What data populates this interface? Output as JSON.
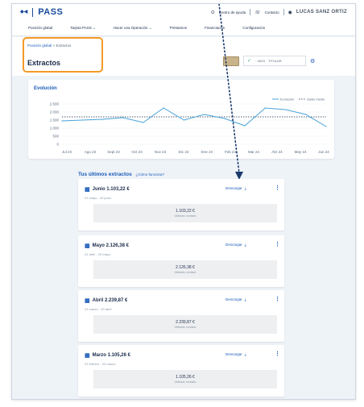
{
  "brand": {
    "name": "PASS"
  },
  "topbar": {
    "help": "Centro de ayuda",
    "contact": "Contacto",
    "user": "LUCAS SANZ ORTIZ"
  },
  "nav": [
    {
      "label": "Posición global"
    },
    {
      "label": "Tarjeta PASS"
    },
    {
      "label": "Hacer una Operación"
    },
    {
      "label": "Préstamos"
    },
    {
      "label": "Financiación"
    },
    {
      "label": "Configuración"
    }
  ],
  "breadcrumb": {
    "home": "Posición global",
    "sep": ">",
    "current": "Extractos"
  },
  "page": {
    "title": "Extractos"
  },
  "account": {
    "number": "···4815",
    "holder": "TITULAR"
  },
  "chart_data": {
    "type": "line",
    "title": "Evolución",
    "categories": [
      "Jul 23",
      "Ago 23",
      "Sept 23",
      "Oct 23",
      "Nov 23",
      "Dic 23",
      "Ene 24",
      "Feb 24",
      "Mar 24",
      "Abr 24",
      "May 24",
      "Jun 24"
    ],
    "series": [
      {
        "name": "Evolución",
        "values": [
          1450,
          1500,
          1550,
          1650,
          1350,
          2250,
          1500,
          1850,
          1600,
          1150,
          2250,
          2150,
          1850,
          1100
        ]
      },
      {
        "name": "Saldo medio",
        "values": [
          1700,
          1700,
          1700,
          1700,
          1700,
          1700,
          1700,
          1700,
          1700,
          1700,
          1700,
          1700,
          1700,
          1700
        ]
      }
    ],
    "yticks": [
      "2.500",
      "2.000",
      "1.500",
      "1.000",
      "500",
      "0"
    ],
    "ylim": [
      0,
      2500
    ],
    "grid": true,
    "legend": "top-right",
    "colors": {
      "evolucion": "#4aa3d8",
      "saldo": "#1a2b4a"
    }
  },
  "statements_section": {
    "title": "Tus últimos extractos",
    "link": "¿Cómo funciona?"
  },
  "statements": [
    {
      "title": "Junio 1.103,22 €",
      "range": "21 mayo - 20 junio",
      "download": "Descargar",
      "amount": "1.103,22 €",
      "sub": "Utilizado contado"
    },
    {
      "title": "Mayo 2.126,38 €",
      "range": "21 abril - 20 mayo",
      "download": "Descargar",
      "amount": "2.126,38 €",
      "sub": "Utilizado contado"
    },
    {
      "title": "Abril 2.239,87 €",
      "range": "21 marzo - 20 abril",
      "download": "Descargar",
      "amount": "2.239,87 €",
      "sub": "Utilizado contado"
    },
    {
      "title": "Marzo 1.105,26 €",
      "range": "21 febrero - 20 marzo",
      "download": "Descargar",
      "amount": "1.105,26 €",
      "sub": "Utilizado contado"
    }
  ]
}
